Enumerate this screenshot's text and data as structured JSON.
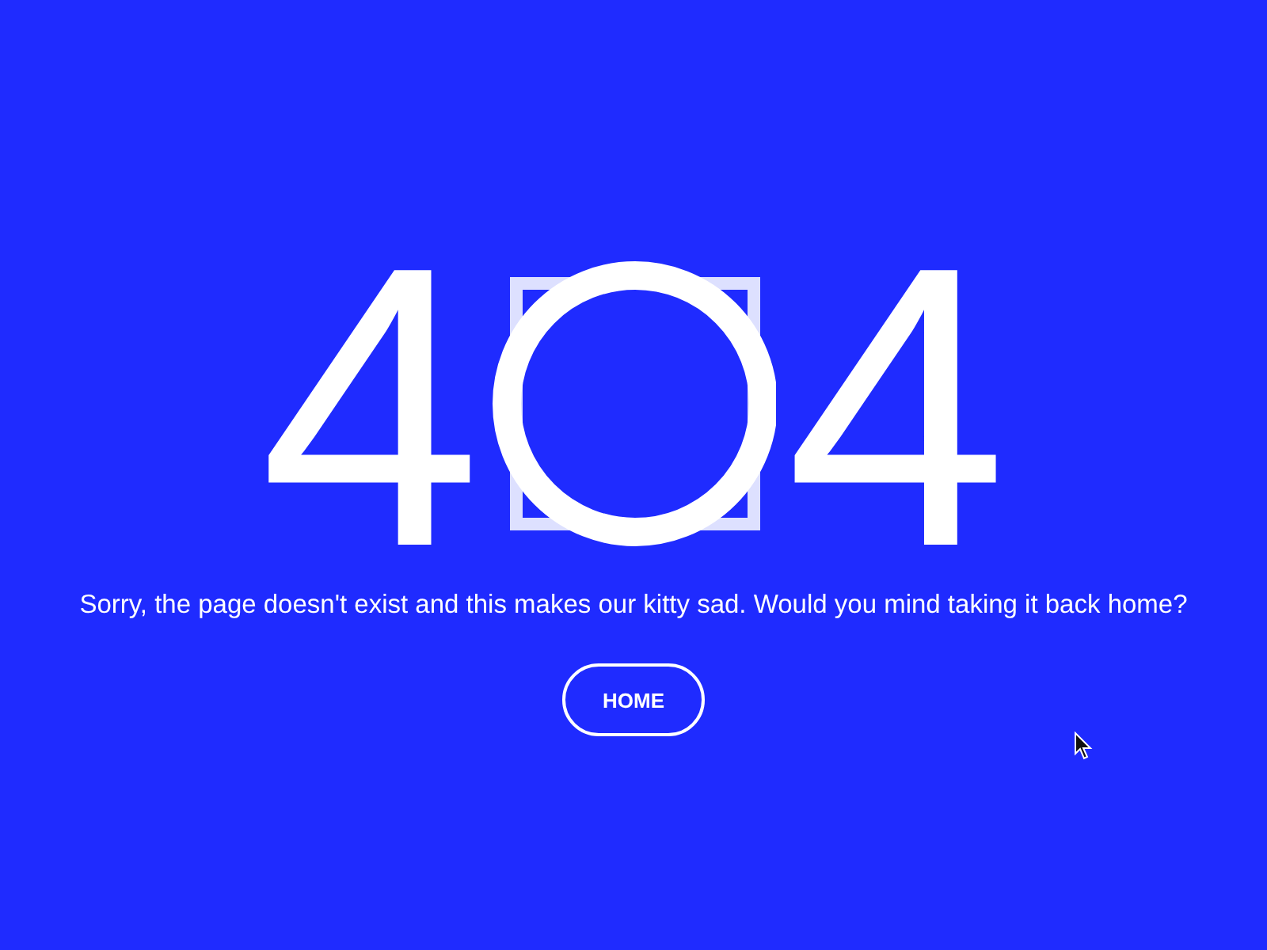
{
  "error_code": [
    {
      "kind": "digit",
      "text": "4"
    },
    {
      "kind": "ring"
    },
    {
      "kind": "digit",
      "text": "4"
    }
  ],
  "message": "Sorry, the page doesn't exist and this makes our kitty sad. Would you mind taking it back home?",
  "home_button": {
    "label": "HOME"
  }
}
